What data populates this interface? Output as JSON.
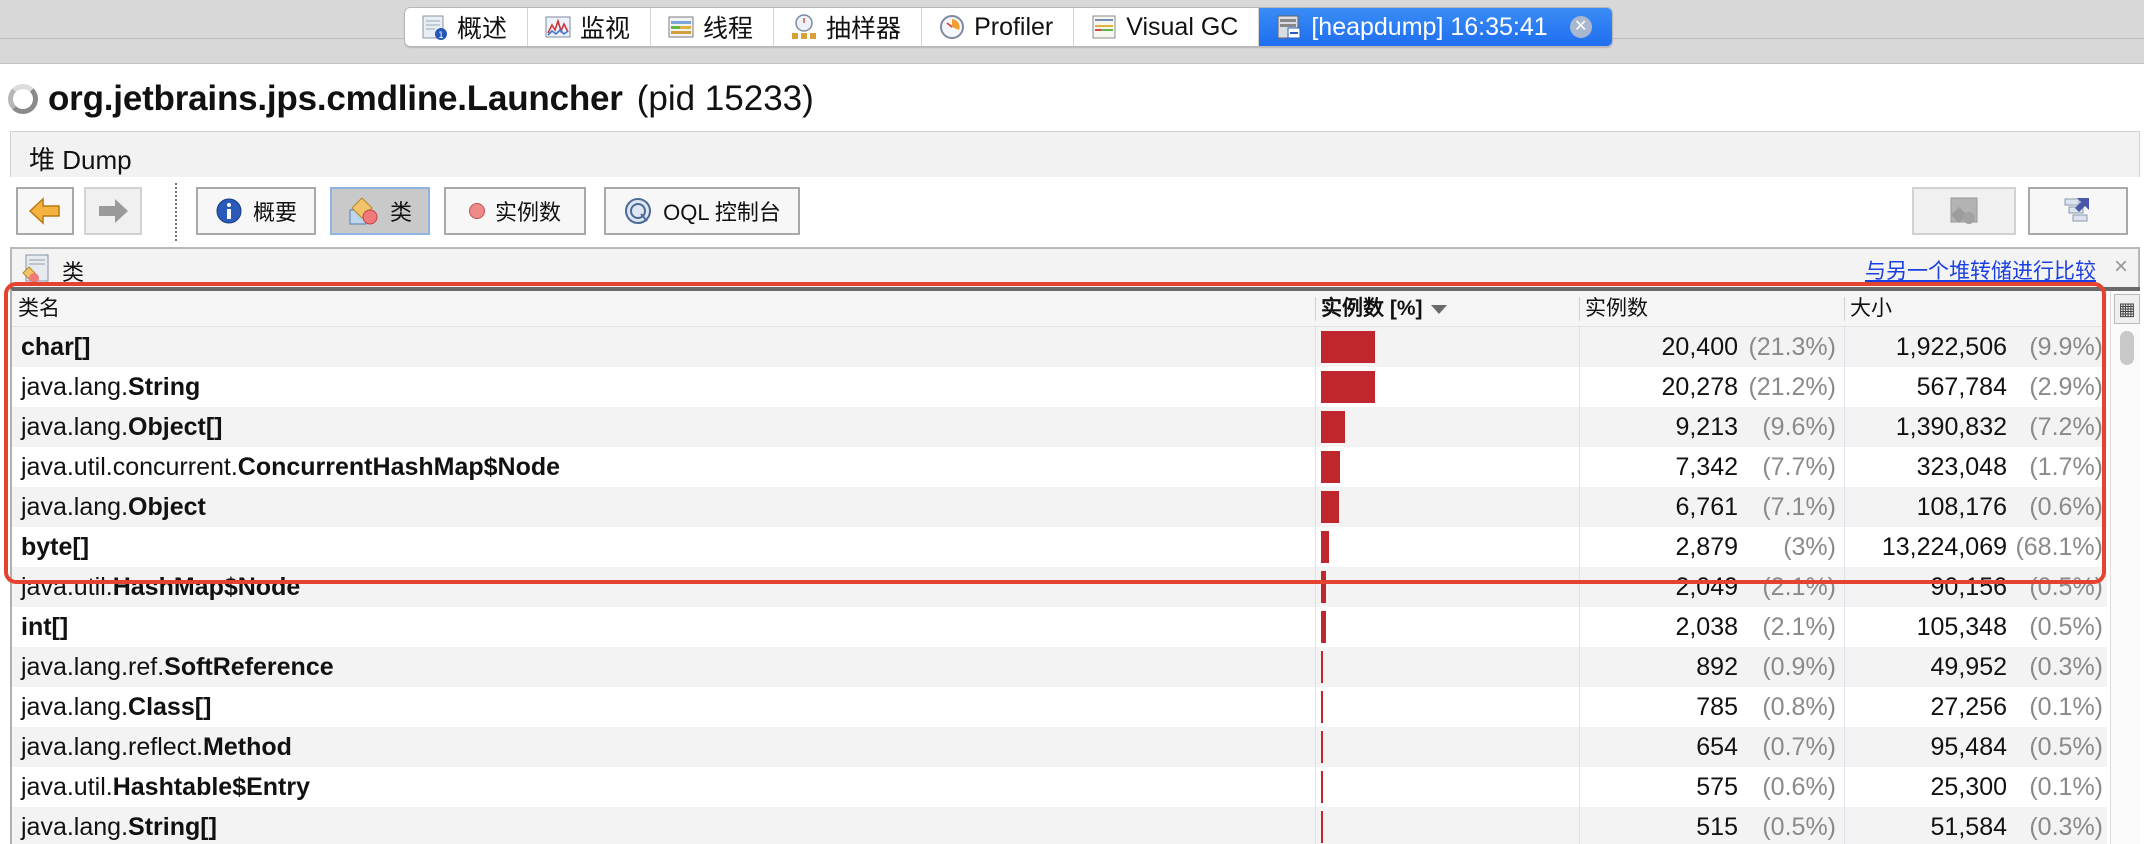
{
  "tabs": [
    {
      "label": "概述",
      "icon": "overview-icon",
      "active": false
    },
    {
      "label": "监视",
      "icon": "monitor-icon",
      "active": false
    },
    {
      "label": "线程",
      "icon": "threads-icon",
      "active": false
    },
    {
      "label": "抽样器",
      "icon": "sampler-icon",
      "active": false
    },
    {
      "label": "Profiler",
      "icon": "profiler-clock-icon",
      "active": false
    },
    {
      "label": "Visual GC",
      "icon": "visual-gc-icon",
      "active": false
    },
    {
      "label": "[heapdump] 16:35:41",
      "icon": "heapdump-icon",
      "active": true,
      "closable": true
    }
  ],
  "title": {
    "main": "org.jetbrains.jps.cmdline.Launcher",
    "pid": "(pid 15233)"
  },
  "dump_bar": {
    "label": "堆 Dump"
  },
  "toolbar": {
    "back_icon": "arrow-left-icon",
    "forward_icon": "arrow-right-icon",
    "buttons": [
      {
        "label": "概要",
        "icon": "info-icon",
        "pressed": false
      },
      {
        "label": "类",
        "icon": "classes-icon",
        "pressed": true
      },
      {
        "label": "实例数",
        "icon": "instance-dot-icon",
        "pressed": false
      },
      {
        "label": "OQL 控制台",
        "icon": "oql-icon",
        "pressed": false
      }
    ],
    "right_buttons": [
      {
        "icon": "class-view-icon",
        "disabled": true
      },
      {
        "icon": "export-table-icon",
        "disabled": false
      }
    ]
  },
  "panel": {
    "label": "类",
    "compare_link": "与另一个堆转储进行比较",
    "close": "×"
  },
  "table": {
    "columns": [
      {
        "label": "类名"
      },
      {
        "label": "实例数 [%]",
        "sorted": "descending"
      },
      {
        "label": "实例数"
      },
      {
        "label": "大小"
      }
    ],
    "rows": [
      {
        "pkg": "",
        "cls": "char[]",
        "instances_pct": 21.3,
        "instances": "20,400",
        "instances_pct_label": "(21.3%)",
        "size": "1,922,506",
        "size_pct_label": "(9.9%)"
      },
      {
        "pkg": "java.lang.",
        "cls": "String",
        "instances_pct": 21.2,
        "instances": "20,278",
        "instances_pct_label": "(21.2%)",
        "size": "567,784",
        "size_pct_label": "(2.9%)"
      },
      {
        "pkg": "java.lang.",
        "cls": "Object[]",
        "instances_pct": 9.6,
        "instances": "9,213",
        "instances_pct_label": "(9.6%)",
        "size": "1,390,832",
        "size_pct_label": "(7.2%)"
      },
      {
        "pkg": "java.util.concurrent.",
        "cls": "ConcurrentHashMap$Node",
        "instances_pct": 7.7,
        "instances": "7,342",
        "instances_pct_label": "(7.7%)",
        "size": "323,048",
        "size_pct_label": "(1.7%)"
      },
      {
        "pkg": "java.lang.",
        "cls": "Object",
        "instances_pct": 7.1,
        "instances": "6,761",
        "instances_pct_label": "(7.1%)",
        "size": "108,176",
        "size_pct_label": "(0.6%)"
      },
      {
        "pkg": "",
        "cls": "byte[]",
        "instances_pct": 3.0,
        "instances": "2,879",
        "instances_pct_label": "(3%)",
        "size": "13,224,069",
        "size_pct_label": "(68.1%)"
      },
      {
        "pkg": "java.util.",
        "cls": "HashMap$Node",
        "instances_pct": 2.1,
        "instances": "2,049",
        "instances_pct_label": "(2.1%)",
        "size": "90,156",
        "size_pct_label": "(0.5%)"
      },
      {
        "pkg": "",
        "cls": "int[]",
        "instances_pct": 2.1,
        "instances": "2,038",
        "instances_pct_label": "(2.1%)",
        "size": "105,348",
        "size_pct_label": "(0.5%)"
      },
      {
        "pkg": "java.lang.ref.",
        "cls": "SoftReference",
        "instances_pct": 0.9,
        "instances": "892",
        "instances_pct_label": "(0.9%)",
        "size": "49,952",
        "size_pct_label": "(0.3%)"
      },
      {
        "pkg": "java.lang.",
        "cls": "Class[]",
        "instances_pct": 0.8,
        "instances": "785",
        "instances_pct_label": "(0.8%)",
        "size": "27,256",
        "size_pct_label": "(0.1%)"
      },
      {
        "pkg": "java.lang.reflect.",
        "cls": "Method",
        "instances_pct": 0.7,
        "instances": "654",
        "instances_pct_label": "(0.7%)",
        "size": "95,484",
        "size_pct_label": "(0.5%)"
      },
      {
        "pkg": "java.util.",
        "cls": "Hashtable$Entry",
        "instances_pct": 0.6,
        "instances": "575",
        "instances_pct_label": "(0.6%)",
        "size": "25,300",
        "size_pct_label": "(0.1%)"
      },
      {
        "pkg": "java.lang.",
        "cls": "String[]",
        "instances_pct": 0.5,
        "instances": "515",
        "instances_pct_label": "(0.5%)",
        "size": "51,584",
        "size_pct_label": "(0.3%)"
      }
    ]
  },
  "colors": {
    "bar": "#c0272d",
    "active_tab": "#2a7cf4",
    "link": "#1a3fe0",
    "highlight_annotation": "#e4432f"
  }
}
